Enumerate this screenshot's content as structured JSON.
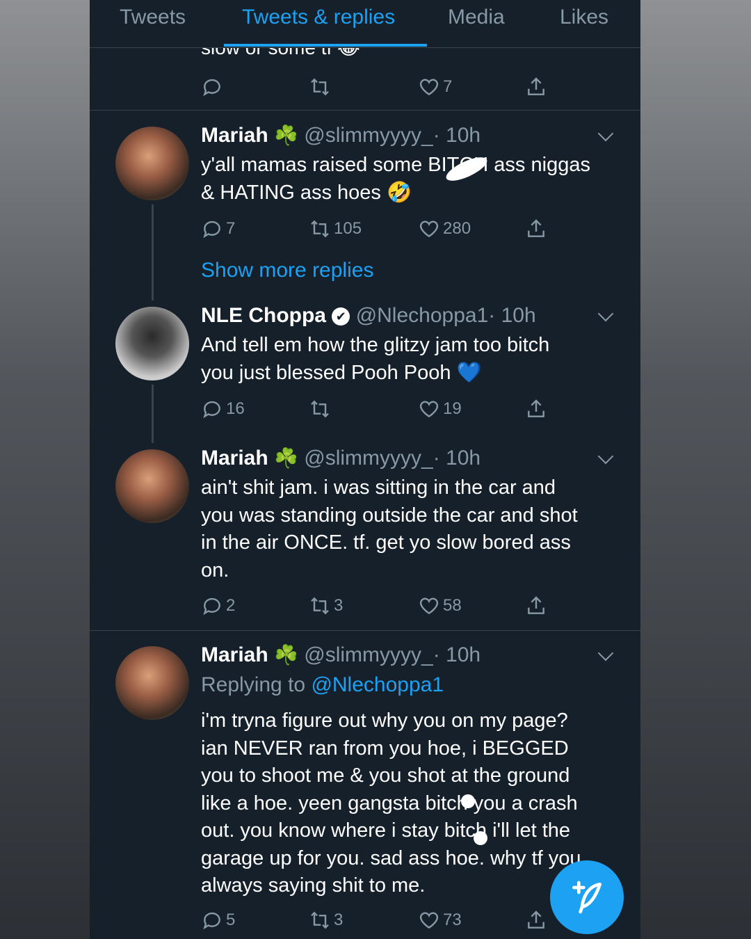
{
  "tabs": [
    "Tweets",
    "Tweets & replies",
    "Media",
    "Likes"
  ],
  "active_tab": 1,
  "colors": {
    "background": "#15202b",
    "accent": "#1da1f2",
    "muted": "#8899a6",
    "divider": "#38444d"
  },
  "top_clip": {
    "text": "slow or some tf 😂",
    "likes": "7"
  },
  "show_more": "Show more replies",
  "tweets": [
    {
      "name": "Mariah",
      "badge": "☘️",
      "handle": "@slimmyyyy_",
      "time": "· 10h",
      "lines": [
        "y'all mamas raised some BITCH ass niggas",
        "& HATING ass hoes 🤣"
      ],
      "replies": "7",
      "retweets": "105",
      "likes": "280"
    },
    {
      "name": "NLE Choppa",
      "badge": "✔",
      "handle": "@Nlechoppa1",
      "time": "· 10h",
      "lines": [
        "And tell em how the glitzy jam too bitch",
        "you just blessed Pooh Pooh 💙"
      ],
      "replies": "16",
      "retweets": "",
      "likes": "19"
    },
    {
      "name": "Mariah",
      "badge": "☘️",
      "handle": "@slimmyyyy_",
      "time": "· 10h",
      "lines": [
        "ain't shit jam. i was sitting in the car and",
        "you was standing outside the car and shot",
        "in the air ONCE. tf. get yo slow bored ass",
        "on."
      ],
      "replies": "2",
      "retweets": "3",
      "likes": "58"
    },
    {
      "name": "Mariah",
      "badge": "☘️",
      "handle": "@slimmyyyy_",
      "time": "· 10h",
      "replying_label": "Replying to",
      "replying_to": "@Nlechoppa1",
      "lines": [
        "i'm tryna figure out why you on my page?",
        "ian NEVER ran from you hoe, i BEGGED",
        "you to shoot me & you shot at the ground",
        "like a hoe. yeen gangsta bitch you a crash",
        "out. you know where i stay bitch i'll let the",
        "garage up for you. sad ass hoe. why tf you",
        "always saying shit to me."
      ],
      "replies": "5",
      "retweets": "3",
      "likes": "73"
    }
  ]
}
